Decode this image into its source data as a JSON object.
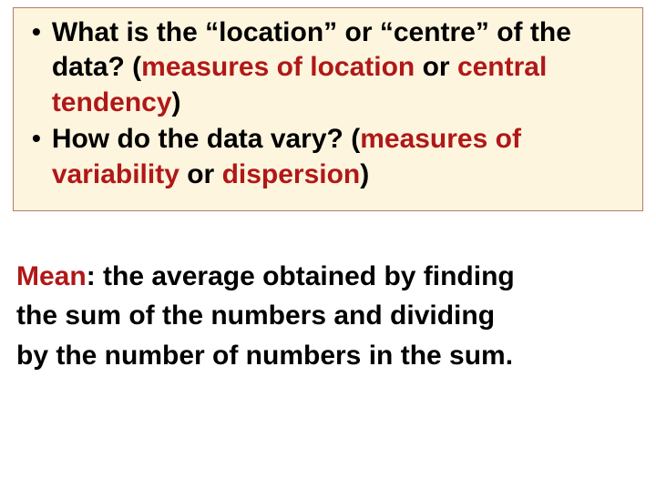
{
  "box": {
    "bullets": [
      {
        "q_prefix": "What is the ",
        "q_quote1": "“location”",
        "q_mid": " or ",
        "q_quote2": "“centre”",
        "q_suffix": " of the data?  ",
        "paren_open": "(",
        "hl1": "measures of location",
        "plain1": " or ",
        "hl2": "central tendency",
        "paren_close": ")"
      },
      {
        "q_text": "How do the data vary?  ",
        "paren_open": "(",
        "hl1": "measures of variability",
        "plain1": " or ",
        "hl2": "dispersion",
        "paren_close": ")"
      }
    ]
  },
  "definition": {
    "term": "Mean",
    "colon": ":  ",
    "line1_rest": "the average obtained by finding",
    "line2": "the sum of the numbers and dividing",
    "line3": "by the number of numbers in the sum."
  }
}
